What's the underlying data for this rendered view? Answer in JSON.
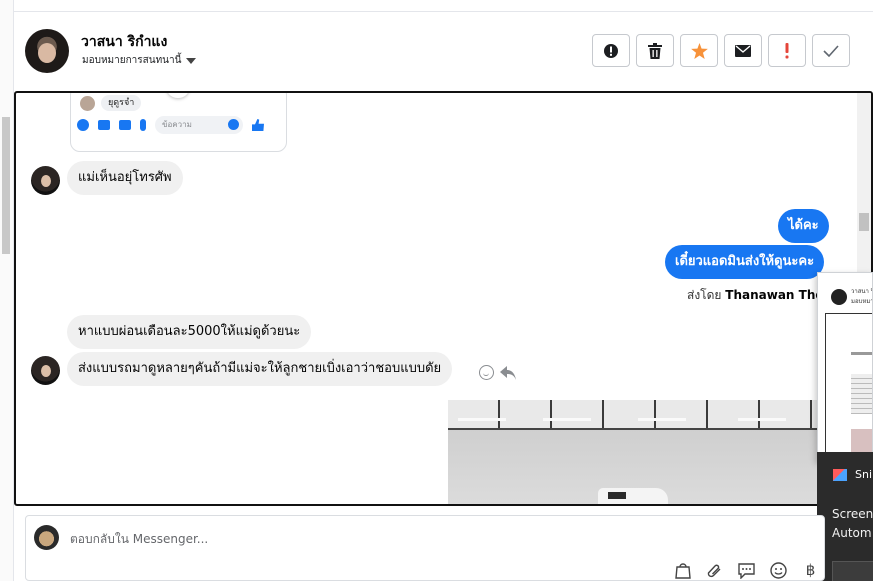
{
  "header": {
    "contact_name": "วาสนา ริกำแง",
    "assign_label": "มอบหมายการสนทนานี้"
  },
  "actions": [
    {
      "name": "spam-button",
      "icon": "alert-circle-icon"
    },
    {
      "name": "delete-button",
      "icon": "trash-icon"
    },
    {
      "name": "star-button",
      "icon": "star-icon",
      "color": "#f7923a"
    },
    {
      "name": "mark-unread-button",
      "icon": "envelope-icon"
    },
    {
      "name": "follow-up-button",
      "icon": "exclamation-icon",
      "color": "#e4453a"
    },
    {
      "name": "done-button",
      "icon": "check-icon"
    }
  ],
  "embed": {
    "chip": "ยุดูรจำ",
    "input_placeholder": "ข้อความ"
  },
  "messages": {
    "m1": "แม่เห็นอยุ่โทรศัพ",
    "m2": "ได้คะ",
    "m3": "เดี๋ยวแอดมินส่งให้ดูนะคะ",
    "sent_by_label": "ส่งโดย",
    "sent_by_name": "Thanawan Thon",
    "m4": "หาแบบผ่อนเดือนละ5000ให้แม่ดูด้วยนะ",
    "m5": "ส่งแบบรถมาดูหลายๆคันถ้ามีแม่จะให้ลูกชายเบิ่งเอาว่าชอบแบบดัย"
  },
  "float_window": {
    "name_line1": "วาสนา ริ",
    "name_line2": "มอบหมาย"
  },
  "snip": {
    "title": "Sni",
    "line1": "Screen",
    "line2": "Autom"
  },
  "composer": {
    "placeholder": "ตอบกลับใน Messenger..."
  },
  "colors": {
    "accent": "#1877f2",
    "star": "#f7923a",
    "alert": "#e4453a"
  }
}
